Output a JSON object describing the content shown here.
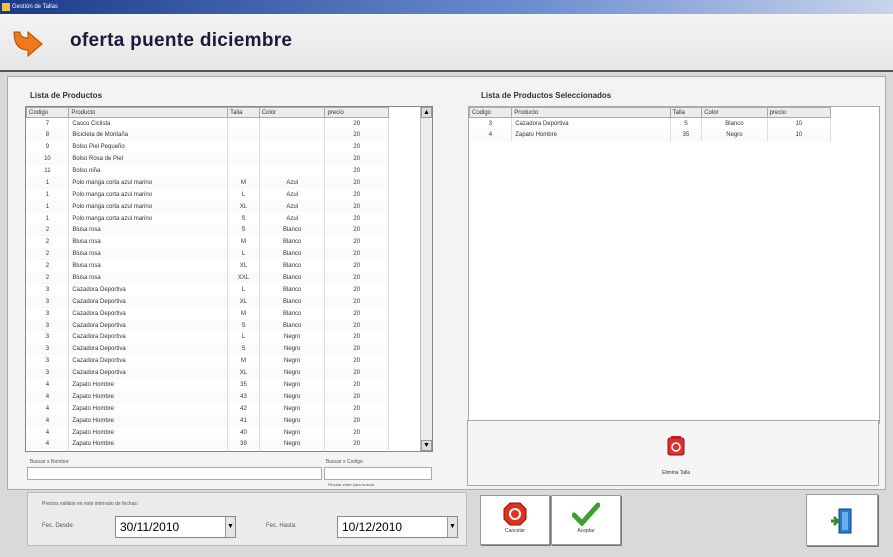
{
  "window": {
    "title": "Gestión de Tallas"
  },
  "header": {
    "title": "oferta puente diciembre"
  },
  "products": {
    "label": "Lista de Productos",
    "columns": [
      "Codigo",
      "Producto",
      "Talla",
      "Color",
      "precio"
    ],
    "rows": [
      [
        "7",
        "Casco Ciclista",
        "",
        "",
        "20"
      ],
      [
        "8",
        "Bicicleta de Montaña",
        "",
        "",
        "20"
      ],
      [
        "9",
        "Bolso Piel Pequeño",
        "",
        "",
        "20"
      ],
      [
        "10",
        "Bolso Rosa de Piel",
        "",
        "",
        "20"
      ],
      [
        "11",
        "Bolso niña",
        "",
        "",
        "20"
      ],
      [
        "1",
        "Polo manga corta azul marino",
        "M",
        "Azul",
        "20"
      ],
      [
        "1",
        "Polo manga corta azul marino",
        "L",
        "Azul",
        "20"
      ],
      [
        "1",
        "Polo manga corta azul marino",
        "XL",
        "Azul",
        "20"
      ],
      [
        "1",
        "Polo manga corta azul marino",
        "S",
        "Azul",
        "20"
      ],
      [
        "2",
        "Blusa rosa",
        "S",
        "Blanco",
        "20"
      ],
      [
        "2",
        "Blusa rosa",
        "M",
        "Blanco",
        "20"
      ],
      [
        "2",
        "Blusa rosa",
        "L",
        "Blanco",
        "20"
      ],
      [
        "2",
        "Blusa rosa",
        "XL",
        "Blanco",
        "20"
      ],
      [
        "2",
        "Blusa rosa",
        "XXL",
        "Blanco",
        "20"
      ],
      [
        "3",
        "Cazadora Deportiva",
        "L",
        "Blanco",
        "20"
      ],
      [
        "3",
        "Cazadora Deportiva",
        "XL",
        "Blanco",
        "20"
      ],
      [
        "3",
        "Cazadora Deportiva",
        "M",
        "Blanco",
        "20"
      ],
      [
        "3",
        "Cazadora Deportiva",
        "S",
        "Blanco",
        "20"
      ],
      [
        "3",
        "Cazadora Deportiva",
        "L",
        "Negro",
        "20"
      ],
      [
        "3",
        "Cazadora Deportiva",
        "S",
        "Negro",
        "20"
      ],
      [
        "3",
        "Cazadora Deportiva",
        "M",
        "Negro",
        "20"
      ],
      [
        "3",
        "Cazadora Deportiva",
        "XL",
        "Negro",
        "20"
      ],
      [
        "4",
        "Zapato Hombre",
        "35",
        "Negro",
        "20"
      ],
      [
        "4",
        "Zapato Hombre",
        "43",
        "Negro",
        "20"
      ],
      [
        "4",
        "Zapato Hombre",
        "42",
        "Negro",
        "20"
      ],
      [
        "4",
        "Zapato Hombre",
        "41",
        "Negro",
        "20"
      ],
      [
        "4",
        "Zapato Hombre",
        "40",
        "Negro",
        "20"
      ],
      [
        "4",
        "Zapato Hombre",
        "39",
        "Negro",
        "20"
      ]
    ]
  },
  "selected": {
    "label": "Lista de Productos Seleccionados",
    "columns": [
      "Codigo",
      "Producto",
      "Talla",
      "Color",
      "precio"
    ],
    "rows": [
      [
        "3",
        "Cazadora Deportiva",
        "S",
        "Blanco",
        "10"
      ],
      [
        "4",
        "Zapato Hombre",
        "35",
        "Negro",
        "10"
      ]
    ]
  },
  "search": {
    "by_name_label": "Buscar  x  Nombre",
    "by_code_label": "Buscar  x  Codigo",
    "hint": "Pinchar enter para buscar"
  },
  "delete_size_label": "Elimina Talla",
  "dates": {
    "intro": "Precios validos en este intervalo de fechas:",
    "from_label": "Fec. Desde:",
    "from_value": "30/11/2010",
    "to_label": "Fec. Hasta:",
    "to_value": "10/12/2010"
  },
  "buttons": {
    "cancel": "Cancelar",
    "accept": "Aceptar"
  }
}
